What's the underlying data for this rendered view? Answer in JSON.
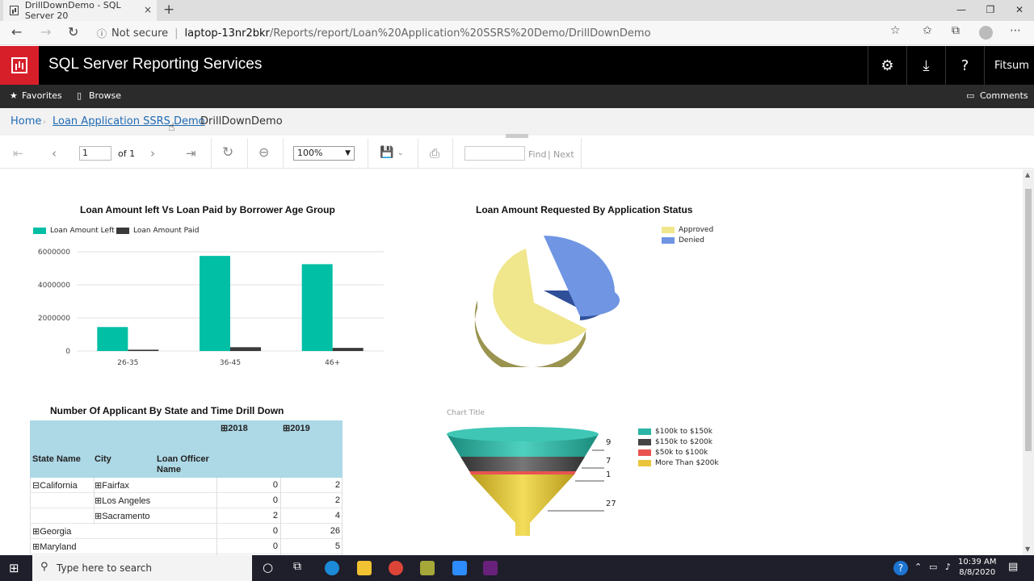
{
  "browser": {
    "tab_title": "DrillDownDemo - SQL Server 20",
    "tab_close": "×",
    "new_tab": "+",
    "security": "Not secure",
    "url_host": "laptop-13nr2bkr",
    "url_path": "/Reports/report/Loan%20Application%20SSRS%20Demo/DrillDownDemo",
    "controls": [
      "—",
      "❐",
      "✕"
    ]
  },
  "ssrs": {
    "title": "SQL Server Reporting Services",
    "user": "Fitsum",
    "favorites": "Favorites",
    "browse": "Browse",
    "comments": "Comments"
  },
  "breadcrumb": {
    "home": "Home",
    "folder": "Loan Application SSRS Demo",
    "current": "DrillDownDemo"
  },
  "toolbar": {
    "page": "1",
    "of": "of 1",
    "zoom": "100%",
    "find": "Find",
    "find_sep": "|",
    "next": "Next"
  },
  "chart_data": [
    {
      "type": "bar",
      "title": "Loan Amount left Vs Loan Paid by Borrower Age Group",
      "categories": [
        "26-35",
        "36-45",
        "46+"
      ],
      "series": [
        {
          "name": "Loan Amount Left",
          "values": [
            1450000,
            5750000,
            5250000
          ],
          "color": "#00bfa5"
        },
        {
          "name": "Loan Amount Paid",
          "values": [
            80000,
            230000,
            190000
          ],
          "color": "#3a3a3a"
        }
      ],
      "ylim": [
        0,
        6000000
      ],
      "yticks": [
        "6000000",
        "4000000",
        "2000000",
        "0"
      ],
      "legend": "top-left"
    },
    {
      "type": "pie",
      "title": "Loan Amount Requested By Application Status",
      "labels": [
        "Approved",
        "Denied"
      ],
      "values": [
        67,
        33
      ],
      "colors": [
        "#f0e68c",
        "#6f95e3"
      ],
      "legend": "top-right"
    },
    {
      "type": "funnel",
      "title": "Chart Title",
      "labels": [
        "$100k to $150k",
        "$150k to $200k",
        "$50k to $100k",
        "More Than $200k"
      ],
      "values": [
        9,
        7,
        1,
        27
      ],
      "value_labels": [
        "9",
        "7",
        "1",
        "27"
      ],
      "colors": [
        "#2bb5a4",
        "#444444",
        "#e8534f",
        "#e8c53a"
      ],
      "legend": "right"
    }
  ],
  "table": {
    "title": "Number Of Applicant By State and Time Drill Down",
    "year1": "2018",
    "year2": "2019",
    "col_state": "State Name",
    "col_city": "City",
    "col_officer_1": "Loan Officer",
    "col_officer_2": "Name",
    "expand_minus": "⊟",
    "expand_plus": "⊞",
    "rows": [
      {
        "state": "California",
        "city": "Fairfax",
        "v2018": "0",
        "v2019": "2"
      },
      {
        "state": "",
        "city": "Los Angeles",
        "v2018": "0",
        "v2019": "2"
      },
      {
        "state": "",
        "city": "Sacramento",
        "v2018": "2",
        "v2019": "4"
      },
      {
        "state": "Georgia",
        "city": "",
        "v2018": "0",
        "v2019": "26"
      },
      {
        "state": "Maryland",
        "city": "",
        "v2018": "0",
        "v2019": "5"
      }
    ]
  },
  "taskbar": {
    "search": "Type here to search",
    "time": "10:39 AM",
    "date": "8/8/2020"
  }
}
